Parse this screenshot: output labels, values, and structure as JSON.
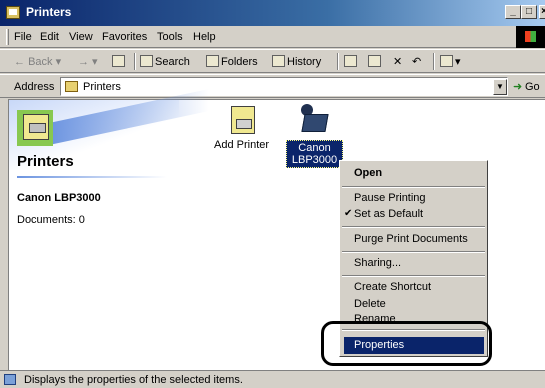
{
  "window": {
    "title": "Printers"
  },
  "menu": [
    "File",
    "Edit",
    "View",
    "Favorites",
    "Tools",
    "Help"
  ],
  "toolbar": {
    "back": "Back",
    "search": "Search",
    "folders": "Folders",
    "history": "History"
  },
  "address": {
    "label": "Address",
    "value": "Printers",
    "go": "Go"
  },
  "info_panel": {
    "title": "Printers",
    "printer_name": "Canon LBP3000",
    "documents": "Documents: 0"
  },
  "icons": {
    "add_printer": "Add Printer",
    "canon_line1": "Canon",
    "canon_line2": "LBP3000"
  },
  "context_menu": {
    "open": "Open",
    "pause_printing": "Pause Printing",
    "set_as_default": "Set as Default",
    "purge": "Purge Print Documents",
    "sharing": "Sharing...",
    "create_shortcut": "Create Shortcut",
    "delete": "Delete",
    "rename": "Rename",
    "properties": "Properties"
  },
  "status": {
    "text": "Displays the properties of the selected items."
  },
  "colors": {
    "selection": "#0a246a",
    "face": "#d4d0c8"
  }
}
